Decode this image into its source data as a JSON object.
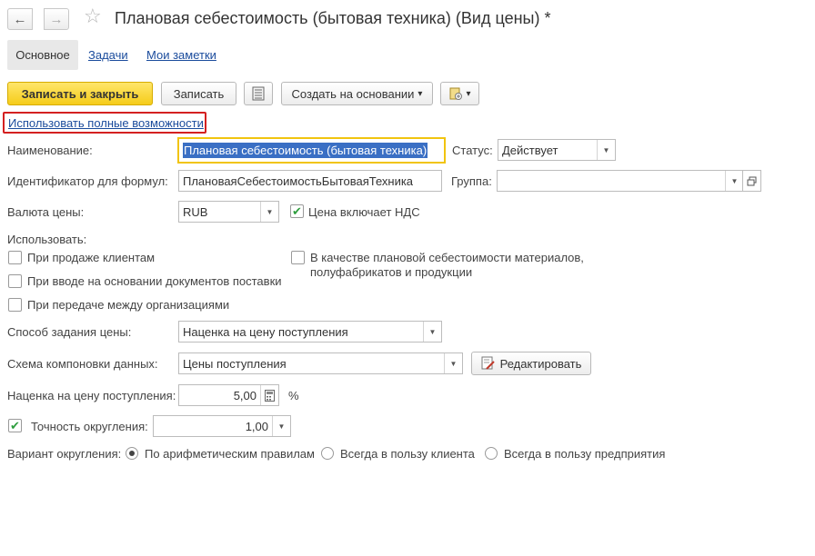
{
  "header": {
    "back_icon": "arrow-left-icon",
    "forward_icon": "arrow-right-icon",
    "favorite_icon": "star-icon",
    "title": "Плановая себестоимость (бытовая техника) (Вид цены) *"
  },
  "tabs": [
    {
      "label": "Основное",
      "active": true
    },
    {
      "label": "Задачи",
      "active": false
    },
    {
      "label": "Мои заметки",
      "active": false
    }
  ],
  "toolbar": {
    "save_close_label": "Записать и закрыть",
    "save_label": "Записать",
    "list_icon": "document-list-icon",
    "create_based_label": "Создать на основании",
    "create_based_arrow": "▾",
    "attach_icon": "paperclip-document-icon",
    "attach_arrow": "▾"
  },
  "full_features_link": "Использовать полные возможности",
  "colors": {
    "accent_yellow": "#f5cc1a",
    "link": "#1a4b9c",
    "highlight_red": "#d42020",
    "focus_border": "#f1c40f",
    "check_green": "#2e9e3e"
  },
  "form": {
    "name_label": "Наименование:",
    "name_value": "Плановая себестоимость (бытовая техника)",
    "status_label": "Статус:",
    "status_value": "Действует",
    "formula_id_label": "Идентификатор для формул:",
    "formula_id_value": "ПлановаяСебестоимостьБытоваяТехника",
    "group_label": "Группа:",
    "group_value": "",
    "currency_label": "Валюта цены:",
    "currency_value": "RUB",
    "vat_label": "Цена включает НДС",
    "vat_checked": true,
    "use_label": "Использовать:",
    "use_options": [
      {
        "label": "При продаже клиентам",
        "checked": false
      },
      {
        "label": "При вводе на основании документов поставки",
        "checked": false
      },
      {
        "label": "При передаче между организациями",
        "checked": false
      }
    ],
    "planned_cost_line1": "В качестве плановой себестоимости материалов,",
    "planned_cost_line2": "полуфабрикатов и продукции",
    "planned_cost_checked": false,
    "price_method_label": "Способ задания цены:",
    "price_method_value": "Наценка на цену поступления",
    "schema_label": "Схема компоновки данных:",
    "schema_value": "Цены поступления",
    "edit_label": "Редактировать",
    "markup_label": "Наценка на цену поступления:",
    "markup_value": "5,00",
    "markup_unit": "%",
    "rounding_label": "Точность округления:",
    "rounding_value": "1,00",
    "rounding_checked": true,
    "rounding_variant_label": "Вариант округления:",
    "rounding_variants": [
      {
        "label": "По арифметическим правилам",
        "selected": true
      },
      {
        "label": "Всегда в пользу клиента",
        "selected": false
      },
      {
        "label": "Всегда в пользу предприятия",
        "selected": false
      }
    ]
  }
}
